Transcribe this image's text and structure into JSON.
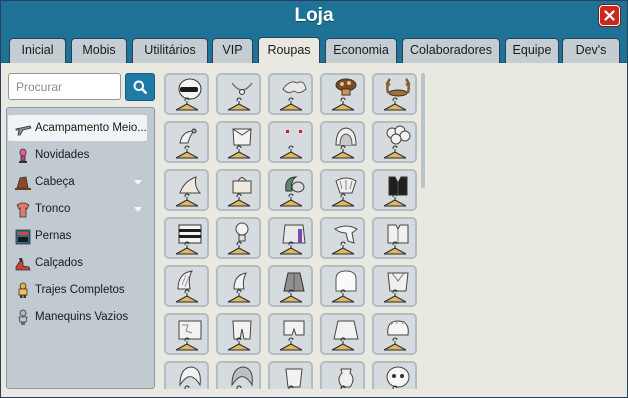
{
  "window": {
    "title": "Loja"
  },
  "tabs": [
    {
      "label": "Inicial",
      "active": false
    },
    {
      "label": "Mobis",
      "active": false
    },
    {
      "label": "Utilitários",
      "active": false
    },
    {
      "label": "VIP",
      "active": false
    },
    {
      "label": "Roupas",
      "active": true
    },
    {
      "label": "Economia",
      "active": false
    },
    {
      "label": "Colaboradores",
      "active": false
    },
    {
      "label": "Equipe",
      "active": false
    },
    {
      "label": "Dev's",
      "active": false
    }
  ],
  "search": {
    "placeholder": "Procurar",
    "value": ""
  },
  "categories": [
    {
      "label": "Acampamento Meio...",
      "icon": "airplane-icon",
      "selected": true,
      "expandable": false
    },
    {
      "label": "Novidades",
      "icon": "pink-lamp-icon",
      "selected": false,
      "expandable": false
    },
    {
      "label": "Cabeça",
      "icon": "hat-icon",
      "selected": false,
      "expandable": true
    },
    {
      "label": "Tronco",
      "icon": "shirt-icon",
      "selected": false,
      "expandable": true
    },
    {
      "label": "Pernas",
      "icon": "pants-icon",
      "selected": false,
      "expandable": false
    },
    {
      "label": "Calçados",
      "icon": "shoes-icon",
      "selected": false,
      "expandable": false
    },
    {
      "label": "Trajes Completos",
      "icon": "full-outfit-icon",
      "selected": false,
      "expandable": false
    },
    {
      "label": "Manequins Vazios",
      "icon": "mannequin-icon",
      "selected": false,
      "expandable": false
    }
  ],
  "items": [
    {
      "icon": "white-balaclava-icon"
    },
    {
      "icon": "white-necklace-icon"
    },
    {
      "icon": "white-lace-icon"
    },
    {
      "icon": "brown-mushroom-hat-icon"
    },
    {
      "icon": "brown-antlers-icon"
    },
    {
      "icon": "white-horn-icon"
    },
    {
      "icon": "white-collar-icon"
    },
    {
      "icon": "red-earrings-icon"
    },
    {
      "icon": "white-hood-icon"
    },
    {
      "icon": "white-curly-wig-icon"
    },
    {
      "icon": "white-cone-hat-icon"
    },
    {
      "icon": "white-bag-icon"
    },
    {
      "icon": "green-plume-icon"
    },
    {
      "icon": "white-beard-icon"
    },
    {
      "icon": "black-vest-icon"
    },
    {
      "icon": "striped-shirt-icon"
    },
    {
      "icon": "white-lamp-icon"
    },
    {
      "icon": "purple-cape-icon"
    },
    {
      "icon": "white-scarf-icon"
    },
    {
      "icon": "white-jacket-icon"
    },
    {
      "icon": "white-wing-icon"
    },
    {
      "icon": "white-feather-icon"
    },
    {
      "icon": "grey-cloak-icon"
    },
    {
      "icon": "white-ghost-icon"
    },
    {
      "icon": "white-tunic-icon"
    },
    {
      "icon": "white-map-shirt-icon"
    },
    {
      "icon": "white-pants-icon"
    },
    {
      "icon": "white-shorts-icon"
    },
    {
      "icon": "white-skirt-icon"
    },
    {
      "icon": "white-fluffy-hat-icon"
    },
    {
      "icon": "white-hair-icon"
    },
    {
      "icon": "grey-hair-icon"
    },
    {
      "icon": "white-top-icon"
    },
    {
      "icon": "white-vase-icon"
    },
    {
      "icon": "white-mask-icon"
    }
  ],
  "colors": {
    "titlebar": "#1e7295",
    "accent_button": "#1e7aa6",
    "close_button": "#c42a20",
    "tab_inactive": "#c3cdd2",
    "panel": "#e9e9e1",
    "sidebar": "#c1cad0"
  }
}
